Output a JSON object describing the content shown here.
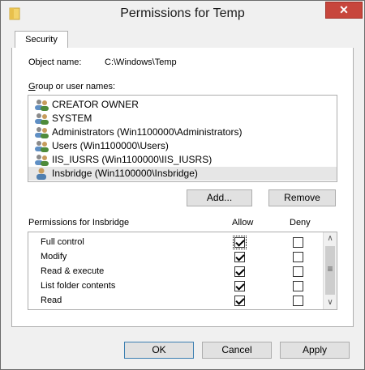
{
  "window": {
    "title": "Permissions for Temp",
    "close_glyph": "✕"
  },
  "tabs": [
    {
      "label": "Security"
    }
  ],
  "object": {
    "label": "Object name:",
    "value": "C:\\Windows\\Temp"
  },
  "group_label": "Group or user names:",
  "users": [
    {
      "name": "CREATOR OWNER",
      "icon": "user-group-icon"
    },
    {
      "name": "SYSTEM",
      "icon": "user-group-icon"
    },
    {
      "name": "Administrators (Win1100000\\Administrators)",
      "icon": "user-group-icon"
    },
    {
      "name": "Users (Win1100000\\Users)",
      "icon": "user-group-icon"
    },
    {
      "name": "IIS_IUSRS (Win1100000\\IIS_IUSRS)",
      "icon": "user-group-icon"
    },
    {
      "name": "Insbridge (Win1100000\\Insbridge)",
      "icon": "single-user-icon",
      "selected": true
    }
  ],
  "buttons": {
    "add": "Add...",
    "remove": "Remove",
    "ok": "OK",
    "cancel": "Cancel",
    "apply": "Apply"
  },
  "permissions": {
    "label": "Permissions for Insbridge",
    "allow_header": "Allow",
    "deny_header": "Deny",
    "rows": [
      {
        "name": "Full control",
        "allow": true,
        "deny": false
      },
      {
        "name": "Modify",
        "allow": true,
        "deny": false
      },
      {
        "name": "Read & execute",
        "allow": true,
        "deny": false
      },
      {
        "name": "List folder contents",
        "allow": true,
        "deny": false
      },
      {
        "name": "Read",
        "allow": true,
        "deny": false
      }
    ]
  },
  "colors": {
    "close_button": "#c7463c",
    "default_button_border": "#3c7fb1",
    "selected_row": "#e6e6e6"
  }
}
